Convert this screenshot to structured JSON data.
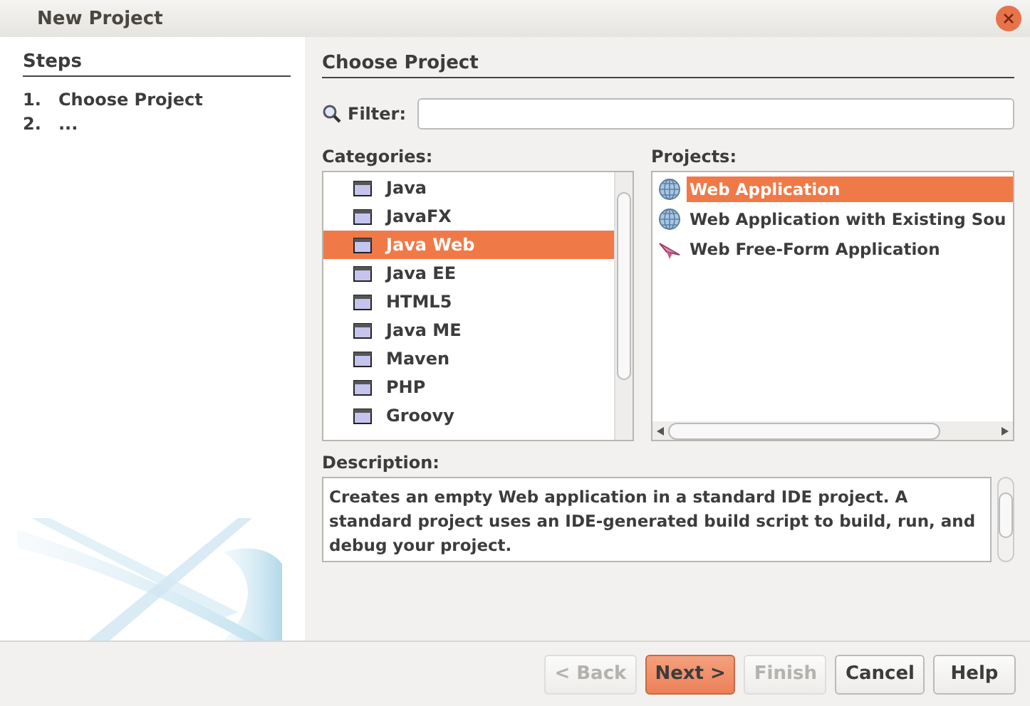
{
  "window": {
    "title": "New Project"
  },
  "steps": {
    "title": "Steps",
    "items": [
      {
        "number": "1.",
        "label": "Choose Project"
      },
      {
        "number": "2.",
        "label": "..."
      }
    ]
  },
  "panel": {
    "title": "Choose Project"
  },
  "filter": {
    "label": "Filter:"
  },
  "categories": {
    "label": "Categories:",
    "items": [
      {
        "label": "Java",
        "selected": false
      },
      {
        "label": "JavaFX",
        "selected": false
      },
      {
        "label": "Java Web",
        "selected": true
      },
      {
        "label": "Java EE",
        "selected": false
      },
      {
        "label": "HTML5",
        "selected": false
      },
      {
        "label": "Java ME",
        "selected": false
      },
      {
        "label": "Maven",
        "selected": false
      },
      {
        "label": "PHP",
        "selected": false
      },
      {
        "label": "Groovy",
        "selected": false
      }
    ]
  },
  "projects": {
    "label": "Projects:",
    "items": [
      {
        "label": "Web Application",
        "kind": "globe",
        "selected": true
      },
      {
        "label": "Web Application with Existing Sou",
        "kind": "globe",
        "selected": false
      },
      {
        "label": "Web Free-Form Application",
        "kind": "freeform",
        "selected": false
      }
    ]
  },
  "description": {
    "label": "Description:",
    "text": "Creates an empty Web application in a standard IDE project. A standard project uses an IDE-generated build script to build, run, and debug your project."
  },
  "buttons": [
    {
      "label": "< Back",
      "disabled": true,
      "default": false
    },
    {
      "label": "Next >",
      "disabled": false,
      "default": true
    },
    {
      "label": "Finish",
      "disabled": true,
      "default": false
    },
    {
      "label": "Cancel",
      "disabled": false,
      "default": false
    },
    {
      "label": "Help",
      "disabled": false,
      "default": false
    }
  ]
}
